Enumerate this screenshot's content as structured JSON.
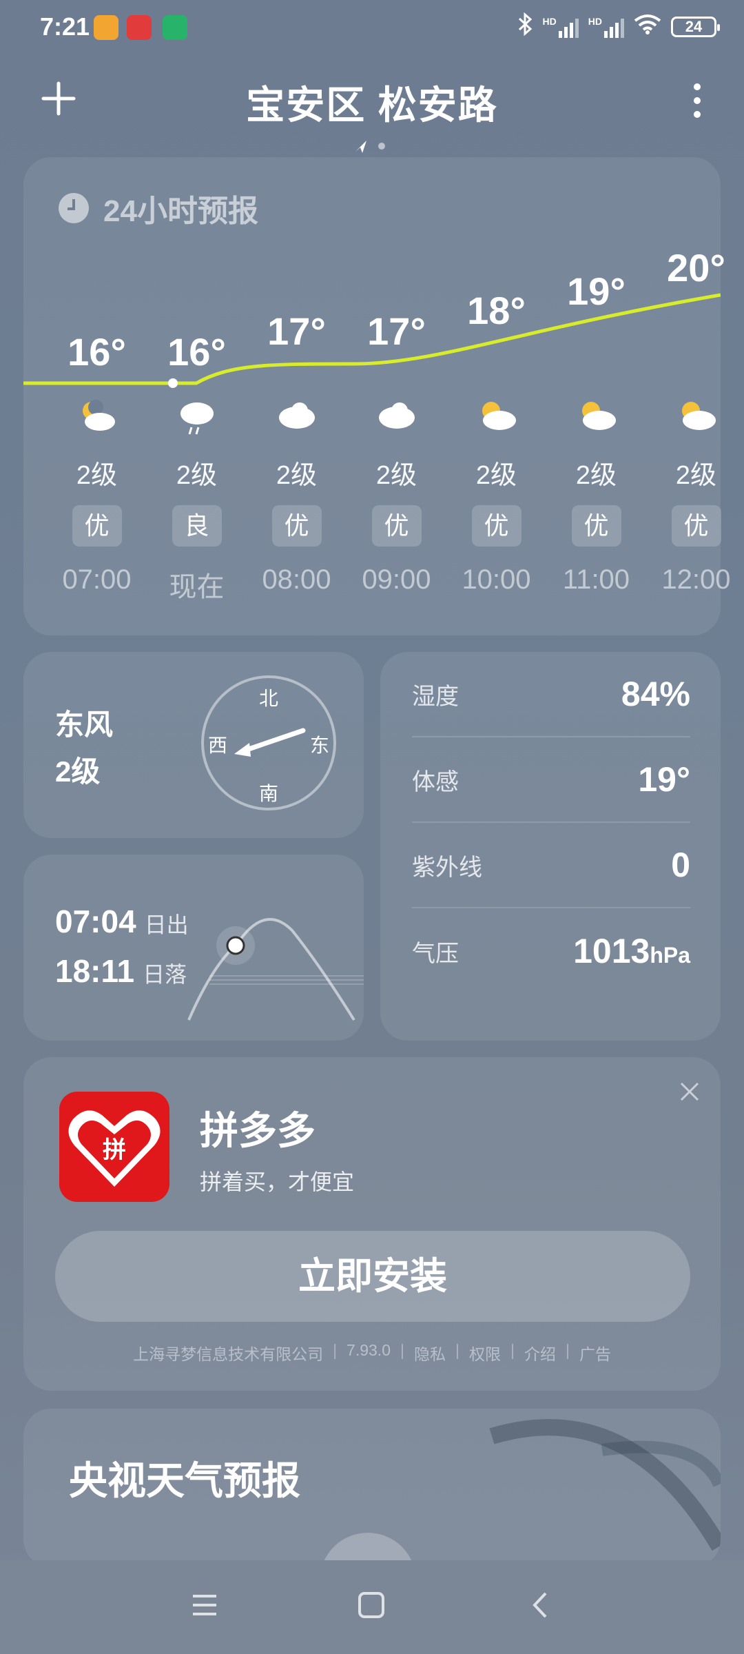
{
  "status_bar": {
    "time": "7:21",
    "hd1": "HD",
    "hd2": "HD",
    "battery": "24"
  },
  "header": {
    "title": "宝安区 松安路"
  },
  "hourly": {
    "title": "24小时预报",
    "items": [
      {
        "temp": "16°",
        "icon": "moon-cloud-icon",
        "wind": "2级",
        "aqi": "优",
        "time": "07:00"
      },
      {
        "temp": "16°",
        "icon": "light-rain-icon",
        "wind": "2级",
        "aqi": "良",
        "time": "现在"
      },
      {
        "temp": "17°",
        "icon": "cloudy-icon",
        "wind": "2级",
        "aqi": "优",
        "time": "08:00"
      },
      {
        "temp": "17°",
        "icon": "cloudy-icon",
        "wind": "2级",
        "aqi": "优",
        "time": "09:00"
      },
      {
        "temp": "18°",
        "icon": "partly-sunny-icon",
        "wind": "2级",
        "aqi": "优",
        "time": "10:00"
      },
      {
        "temp": "19°",
        "icon": "partly-sunny-icon",
        "wind": "2级",
        "aqi": "优",
        "time": "11:00"
      },
      {
        "temp": "20°",
        "icon": "partly-sunny-icon",
        "wind": "2级",
        "aqi": "优",
        "time": "12:00"
      }
    ],
    "line_color": "#d8ec2c"
  },
  "wind": {
    "direction": "东风",
    "level": "2级",
    "compass": {
      "n": "北",
      "s": "南",
      "e": "东",
      "w": "西"
    }
  },
  "sun": {
    "sunrise_time": "07:04",
    "sunrise_label": "日出",
    "sunset_time": "18:11",
    "sunset_label": "日落"
  },
  "details": {
    "humidity_label": "湿度",
    "humidity_value": "84%",
    "feels_label": "体感",
    "feels_value": "19°",
    "uv_label": "紫外线",
    "uv_value": "0",
    "pressure_label": "气压",
    "pressure_value": "1013",
    "pressure_unit": "hPa"
  },
  "ad": {
    "app_name": "拼多多",
    "slogan": "拼着买，才便宜",
    "install_label": "立即安装",
    "logo_char": "拼",
    "brand_color": "#e0171b",
    "meta": {
      "company": "上海寻梦信息技术有限公司",
      "version": "7.93.0",
      "privacy": "隐私",
      "permissions": "权限",
      "intro": "介绍",
      "ad_label": "广告"
    }
  },
  "cctv": {
    "title": "央视天气预报"
  }
}
